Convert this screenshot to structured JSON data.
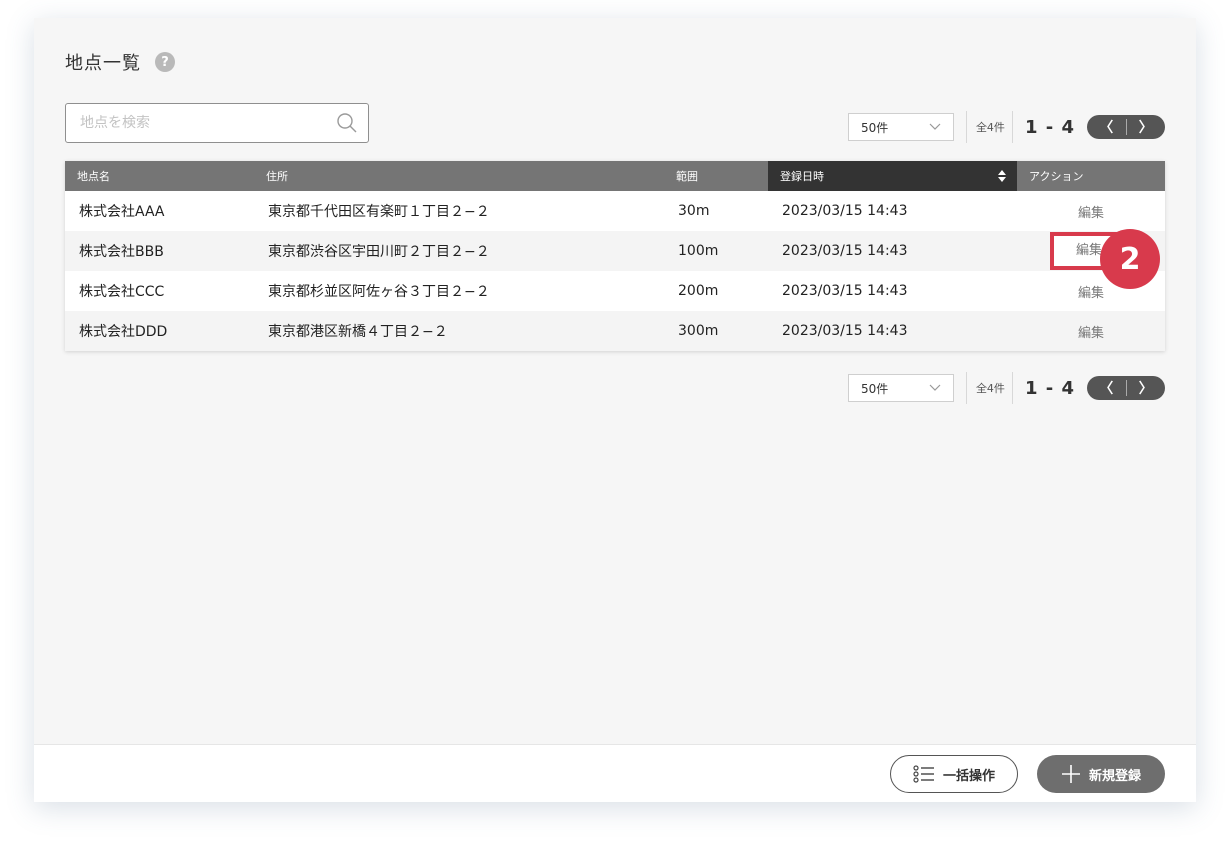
{
  "page": {
    "title": "地点一覧",
    "help_glyph": "?"
  },
  "search": {
    "placeholder": "地点を検索",
    "value": ""
  },
  "pagination": {
    "per_page": "50件",
    "total": "全4件",
    "range": "1 - 4",
    "prev_glyph": "〈",
    "next_glyph": "〉"
  },
  "table": {
    "headers": {
      "name": "地点名",
      "address": "住所",
      "range": "範囲",
      "registered": "登録日時",
      "action": "アクション"
    },
    "rows": [
      {
        "name": "株式会社AAA",
        "address": "東京都千代田区有楽町１丁目２−２",
        "range": "30m",
        "registered": "2023/03/15 14:43",
        "action": "編集"
      },
      {
        "name": "株式会社BBB",
        "address": "東京都渋谷区宇田川町２丁目２−２",
        "range": "100m",
        "registered": "2023/03/15 14:43",
        "action": "編集"
      },
      {
        "name": "株式会社CCC",
        "address": "東京都杉並区阿佐ヶ谷３丁目２−２",
        "range": "200m",
        "registered": "2023/03/15 14:43",
        "action": "編集"
      },
      {
        "name": "株式会社DDD",
        "address": "東京都港区新橋４丁目２−２",
        "range": "300m",
        "registered": "2023/03/15 14:43",
        "action": "編集"
      }
    ]
  },
  "callout": {
    "number": "2"
  },
  "footer": {
    "bulk_label": "一括操作",
    "new_label": "新規登録"
  },
  "colors": {
    "accent": "#d83a4c",
    "header_bg": "#757575",
    "sorted_header_bg": "#333333"
  }
}
